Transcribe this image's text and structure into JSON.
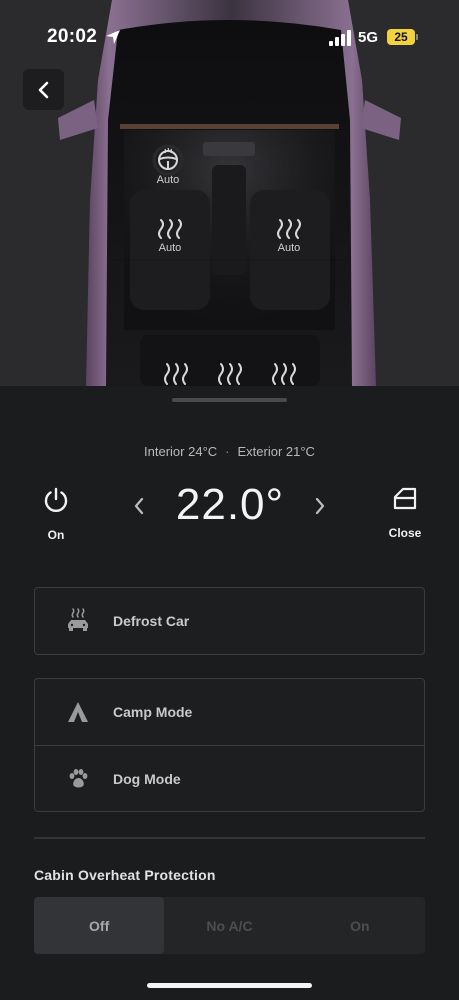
{
  "status_bar": {
    "time": "20:02",
    "network": "5G",
    "battery": "25"
  },
  "car_view": {
    "steering_heat_label": "Auto",
    "front_left_heat_label": "Auto",
    "front_right_heat_label": "Auto"
  },
  "climate": {
    "interior": "Interior 24°C",
    "separator": "·",
    "exterior": "Exterior 21°C",
    "temperature": "22.0°",
    "power_label": "On",
    "window_label": "Close"
  },
  "modes": {
    "defrost": "Defrost Car",
    "camp": "Camp Mode",
    "dog": "Dog Mode"
  },
  "overheat": {
    "title": "Cabin Overheat Protection",
    "options": [
      "Off",
      "No A/C",
      "On"
    ],
    "selected": "Off"
  },
  "colors": {
    "background": "#1b1c1e",
    "car_body": "#6a5470",
    "battery": "#f2d33d"
  }
}
